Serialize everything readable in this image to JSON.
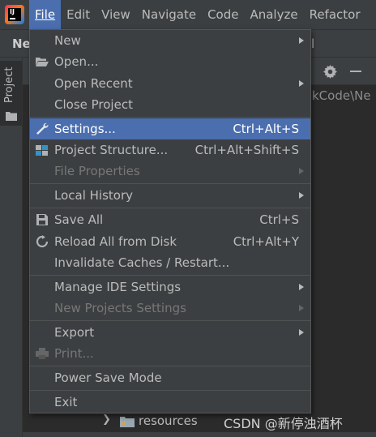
{
  "menubar": {
    "items": [
      {
        "label": "File",
        "mnemonic_rest": "",
        "active": true
      },
      {
        "label": "Edit"
      },
      {
        "label": "View"
      },
      {
        "label": "Navigate"
      },
      {
        "label": "Code"
      },
      {
        "label": "Analyze"
      },
      {
        "label": "Refactor"
      }
    ]
  },
  "navbar": {
    "project_name": "Ne",
    "right_fragment": "l"
  },
  "tool_strip": {
    "project_tab": "Project"
  },
  "project_view": {
    "path_fragment": "kCode\\Ne",
    "tree_item": "resources"
  },
  "watermark": "CSDN @新停浊酒杯",
  "file_menu": {
    "items": [
      {
        "label": "New",
        "icon": "",
        "shortcut": "",
        "submenu": true,
        "disabled": false
      },
      {
        "label": "Open...",
        "icon": "open-folder-icon",
        "shortcut": "",
        "submenu": false,
        "disabled": false
      },
      {
        "label": "Open Recent",
        "icon": "",
        "shortcut": "",
        "submenu": true,
        "disabled": false
      },
      {
        "label": "Close Project",
        "icon": "",
        "shortcut": "",
        "submenu": false,
        "disabled": false
      },
      {
        "label": "Settings...",
        "icon": "wrench-icon",
        "shortcut": "Ctrl+Alt+S",
        "submenu": false,
        "disabled": false,
        "selected": true
      },
      {
        "label": "Project Structure...",
        "icon": "project-structure-icon",
        "shortcut": "Ctrl+Alt+Shift+S",
        "submenu": false,
        "disabled": false
      },
      {
        "label": "File Properties",
        "icon": "",
        "shortcut": "",
        "submenu": true,
        "disabled": true
      },
      {
        "label": "Local History",
        "icon": "",
        "shortcut": "",
        "submenu": true,
        "disabled": false
      },
      {
        "label": "Save All",
        "icon": "save-icon",
        "shortcut": "Ctrl+S",
        "submenu": false,
        "disabled": false
      },
      {
        "label": "Reload All from Disk",
        "icon": "reload-icon",
        "shortcut": "Ctrl+Alt+Y",
        "submenu": false,
        "disabled": false
      },
      {
        "label": "Invalidate Caches / Restart...",
        "icon": "",
        "shortcut": "",
        "submenu": false,
        "disabled": false
      },
      {
        "label": "Manage IDE Settings",
        "icon": "",
        "shortcut": "",
        "submenu": true,
        "disabled": false
      },
      {
        "label": "New Projects Settings",
        "icon": "",
        "shortcut": "",
        "submenu": true,
        "disabled": true
      },
      {
        "label": "Export",
        "icon": "",
        "shortcut": "",
        "submenu": true,
        "disabled": false
      },
      {
        "label": "Print...",
        "icon": "print-icon",
        "shortcut": "",
        "submenu": false,
        "disabled": true
      },
      {
        "label": "Power Save Mode",
        "icon": "",
        "shortcut": "",
        "submenu": false,
        "disabled": false
      },
      {
        "label": "Exit",
        "icon": "",
        "shortcut": "",
        "submenu": false,
        "disabled": false
      }
    ]
  },
  "colors": {
    "menu_background": "#3c3f41",
    "selection": "#4b6eaf",
    "text": "#bbbbbb",
    "disabled_text": "#777777",
    "editor_background": "#2b2b2b"
  }
}
